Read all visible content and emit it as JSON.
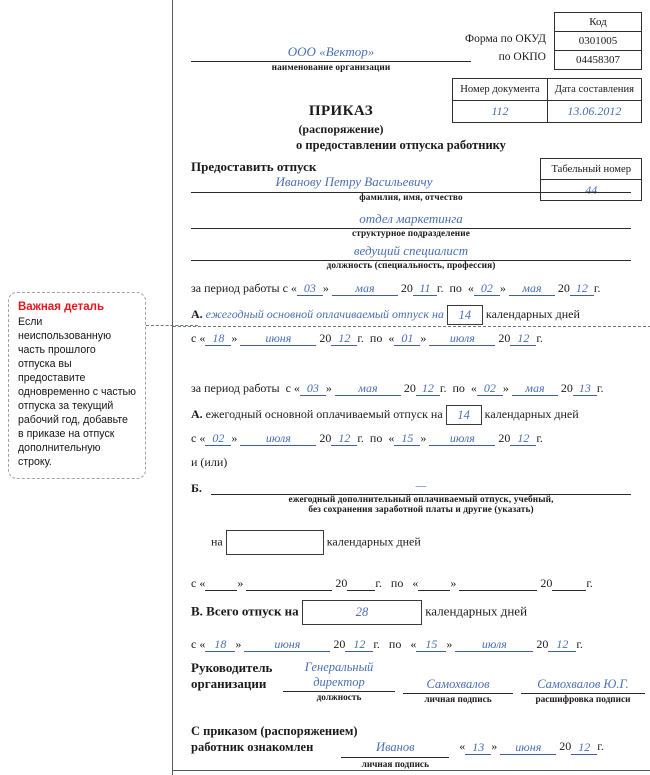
{
  "callout": {
    "title": "Важная деталь",
    "text": "Если неиспользованную часть прошлого отпуска вы предоставите одновременно с частью отпуска за текущий рабочий год, добавьте в приказе на отпуск дополнительную строку."
  },
  "header": {
    "code_label": "Код",
    "okud_label": "Форма по ОКУД",
    "okud_value": "0301005",
    "okpo_label": "по ОКПО",
    "okpo_value": "04458307",
    "org_name": "ООО «Вектор»",
    "org_caption": "наименование организации"
  },
  "doc_table": {
    "number_header": "Номер документа",
    "date_header": "Дата составления",
    "number_value": "112",
    "date_value": "13.06.2012"
  },
  "title": {
    "main": "ПРИКАЗ",
    "sub": "(распоряжение)",
    "about": "о предоставлении отпуска работнику"
  },
  "employee": {
    "grant_label": "Предоставить отпуск",
    "tab_header": "Табельный номер",
    "tab_value": "44",
    "fio_value": "Иванову Петру Васильевичу",
    "fio_caption": "фамилия, имя, отчество",
    "dept_value": "отдел маркетинга",
    "dept_caption": "структурное подразделение",
    "position_value": "ведущий специалист",
    "position_caption": "должность (специальность, профессия)"
  },
  "period_labels": {
    "work_period": "за период работы",
    "from": "с",
    "to": "по",
    "year_prefix": "20",
    "year_suffix": "г.",
    "quote_open": "«",
    "quote_close": "»",
    "calendar_days": "календарных дней"
  },
  "block1": {
    "work_period_label": "за период работы",
    "from_day": "03",
    "from_month": "мая",
    "from_year": "11",
    "to_day": "02",
    "to_month": "мая",
    "to_year": "12",
    "section_letter": "А.",
    "section_text": "ежегодный основной оплачиваемый отпуск на",
    "days": "14",
    "leave_from_day": "18",
    "leave_from_month": "июня",
    "leave_from_year": "12",
    "leave_to_day": "01",
    "leave_to_month": "июля",
    "leave_to_year": "12"
  },
  "block2": {
    "work_period_label": "за период работы",
    "from_day": "03",
    "from_month": "мая",
    "from_year": "12",
    "to_day": "02",
    "to_month": "мая",
    "to_year": "13",
    "section_letter": "А.",
    "section_text": "ежегодный основной оплачиваемый отпуск на",
    "days": "14",
    "leave_from_day": "02",
    "leave_from_month": "июля",
    "leave_from_year": "12",
    "leave_to_day": "15",
    "leave_to_month": "июля",
    "leave_to_year": "12"
  },
  "and_or": "и (или)",
  "section_b": {
    "letter": "Б.",
    "value": "—",
    "caption_line1": "ежегодный дополнительный оплачиваемый отпуск, учебный,",
    "caption_line2": "без сохранения заработной платы и другие (указать)",
    "na_label": "на",
    "days": "",
    "calendar_days": "календарных дней",
    "from_day": "",
    "from_month": "",
    "from_year": "",
    "to_day": "",
    "to_month": "",
    "to_year": ""
  },
  "section_v": {
    "letter": "В.",
    "label": "Всего отпуск на",
    "days": "28",
    "calendar_days": "календарных дней",
    "from_day": "18",
    "from_month": "июня",
    "from_year": "12",
    "to_day": "15",
    "to_month": "июля",
    "to_year": "12"
  },
  "signature": {
    "role_line1": "Руководитель",
    "role_line2": "организации",
    "position_line1": "Генеральный",
    "position_line2": "директор",
    "position_caption": "должность",
    "sign_value": "Самохвалов",
    "sign_caption": "личная подпись",
    "decode_value": "Самохвалов Ю.Г.",
    "decode_caption": "расшифровка подписи"
  },
  "acknowledgement": {
    "line1": "С приказом (распоряжением)",
    "line2": "работник ознакомлен",
    "sign_value": "Иванов",
    "sign_caption": "личная подпись",
    "day": "13",
    "month": "июня",
    "year": "12"
  }
}
